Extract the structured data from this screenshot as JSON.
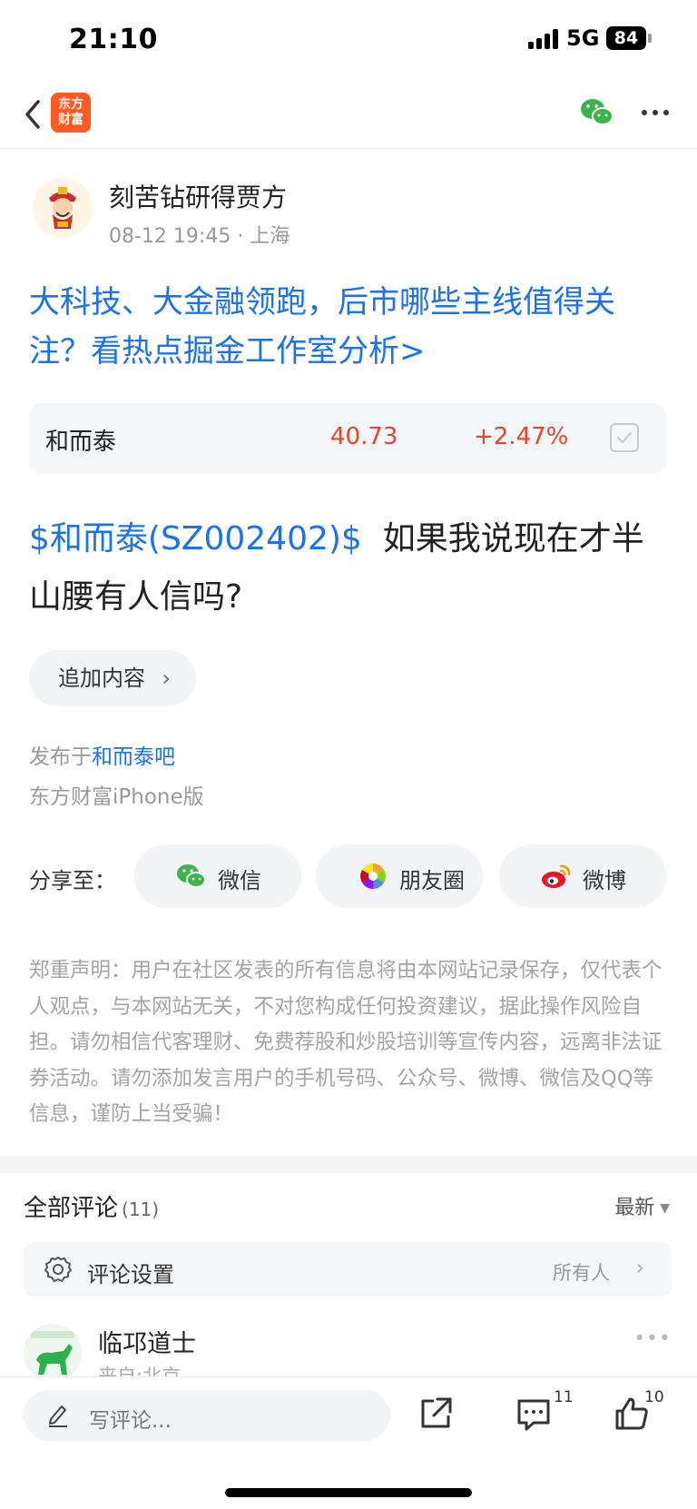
{
  "status": {
    "time": "21:10",
    "network": "5G",
    "battery": "84"
  },
  "nav": {
    "logo_line1": "东方",
    "logo_line2": "财富"
  },
  "author": {
    "name": "刻苦钻研得贾方",
    "meta": "08-12 19:45 · 上海"
  },
  "headline": "大科技、大金融领跑，后市哪些主线值得关注？看热点掘金工作室分析>",
  "stock": {
    "name": "和而泰",
    "price": "40.73",
    "change": "+2.47%"
  },
  "post": {
    "stock_tag": "$和而泰(SZ002402)$",
    "text": "如果我说现在才半山腰有人信吗?"
  },
  "append_label": "追加内容",
  "publish": {
    "prefix": "发布于",
    "bar": "和而泰吧",
    "client": "东方财富iPhone版"
  },
  "share": {
    "label": "分享至：",
    "wechat": "微信",
    "moments": "朋友圈",
    "weibo": "微博"
  },
  "disclaimer": "郑重声明：用户在社区发表的所有信息将由本网站记录保存，仅代表个人观点，与本网站无关，不对您构成任何投资建议，据此操作风险自担。请勿相信代客理财、免费荐股和炒股培训等宣传内容，远离非法证券活动。请勿添加发言用户的手机号码、公众号、微博、微信及QQ等信息，谨防上当受骗！",
  "comments": {
    "title": "全部评论",
    "count": "(11)",
    "sort": "最新",
    "settings_label": "评论设置",
    "settings_value": "所有人",
    "first": {
      "name": "临邛道士",
      "location": "来自:北京"
    }
  },
  "bottom": {
    "placeholder": "写评论...",
    "comment_count": "11",
    "like_count": "10"
  },
  "colors": {
    "link_blue": "#1a73e8",
    "up_red": "#e6442f",
    "brand_orange": "#ff5a1f"
  }
}
